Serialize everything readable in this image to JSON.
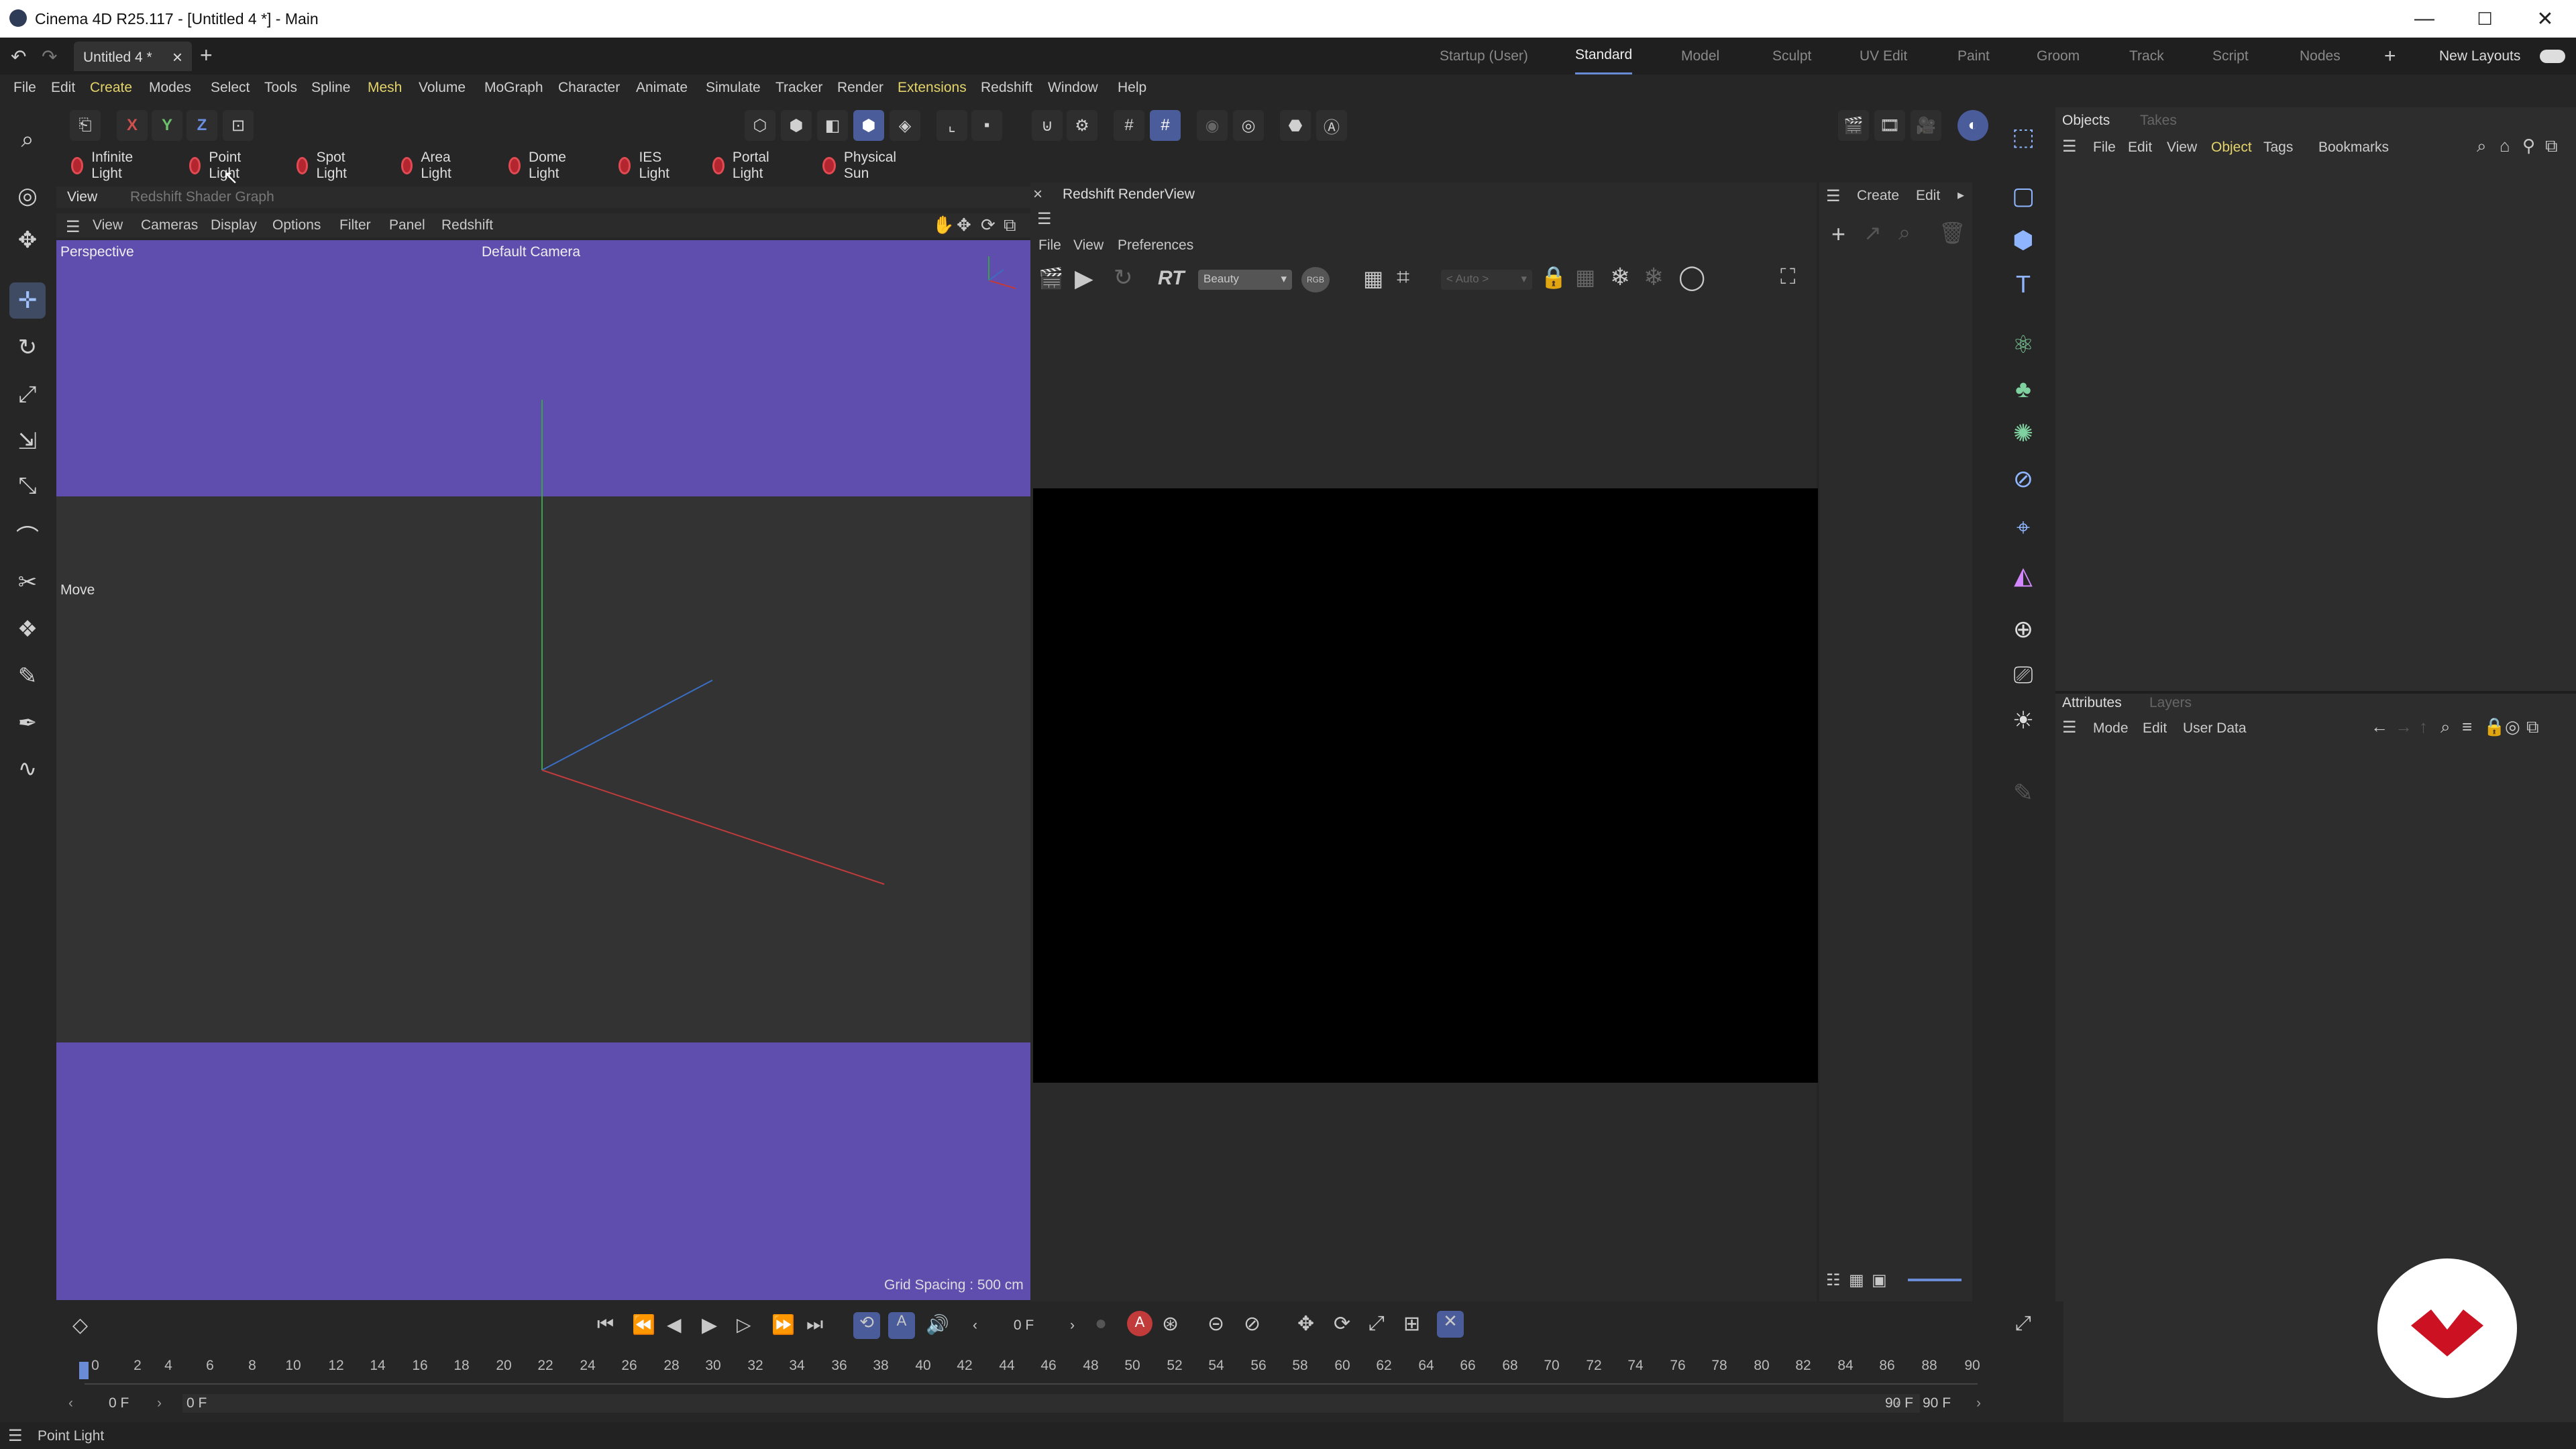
{
  "window": {
    "title": "Cinema 4D R25.117 - [Untitled 4 *] - Main",
    "min": "—",
    "max": "☐",
    "close": "✕"
  },
  "tabs": {
    "doc": "Untitled 4 *",
    "doc_close": "×",
    "add": "+",
    "layouts": [
      "Startup (User)",
      "Standard",
      "Model",
      "Sculpt",
      "UV Edit",
      "Paint",
      "Groom",
      "Track",
      "Script",
      "Nodes"
    ],
    "layout_add": "+",
    "new_layouts": "New Layouts"
  },
  "menu": [
    "File",
    "Edit",
    "Create",
    "Modes",
    "Select",
    "Tools",
    "Spline",
    "Mesh",
    "Volume",
    "MoGraph",
    "Character",
    "Animate",
    "Simulate",
    "Tracker",
    "Render",
    "Extensions",
    "Redshift",
    "Window",
    "Help"
  ],
  "axes": {
    "x": "X",
    "y": "Y",
    "z": "Z"
  },
  "lights": [
    "Infinite Light",
    "Point Light",
    "Spot Light",
    "Area Light",
    "Dome Light",
    "IES Light",
    "Portal Light",
    "Physical Sun"
  ],
  "viewport": {
    "tab_view": "View",
    "tab_shader": "Redshift Shader Graph",
    "menu": [
      "View",
      "Cameras",
      "Display",
      "Options",
      "Filter",
      "Panel",
      "Redshift"
    ],
    "label": "Perspective",
    "camera": "Default Camera",
    "move": "Move",
    "grid": "Grid Spacing : 500 cm"
  },
  "renderview": {
    "title": "Redshift RenderView",
    "close": "×",
    "menu": [
      "File",
      "View",
      "Preferences"
    ],
    "rt": "RT",
    "beauty": "Beauty",
    "rgb": "RGB",
    "auto": "< Auto >"
  },
  "create_panel": {
    "create": "Create",
    "edit": "Edit"
  },
  "objects": {
    "tabs": [
      "Objects",
      "Takes"
    ],
    "menu": [
      "File",
      "Edit",
      "View",
      "Object",
      "Tags",
      "Bookmarks"
    ]
  },
  "attributes": {
    "tabs": [
      "Attributes",
      "Layers"
    ],
    "menu": [
      "Mode",
      "Edit",
      "User Data"
    ]
  },
  "timeline": {
    "frame": "0 F",
    "ticks": [
      "0",
      "2",
      "4",
      "6",
      "8",
      "10",
      "12",
      "14",
      "16",
      "18",
      "20",
      "22",
      "24",
      "26",
      "28",
      "30",
      "32",
      "34",
      "36",
      "38",
      "40",
      "42",
      "44",
      "46",
      "48",
      "50",
      "52",
      "54",
      "56",
      "58",
      "60",
      "62",
      "64",
      "66",
      "68",
      "70",
      "72",
      "74",
      "76",
      "78",
      "80",
      "82",
      "84",
      "86",
      "88",
      "90"
    ],
    "start": "0 F",
    "range_start": "0 F",
    "range_end": "90 F",
    "end": "90 F"
  },
  "status": {
    "text": "Point Light"
  },
  "colors": {
    "accent": "#5f4eae",
    "light_red": "#b3262f",
    "axis_x": "#c23b3b",
    "axis_y": "#3aa34a",
    "axis_z": "#3a6ec2",
    "badge": "#cc1122"
  }
}
